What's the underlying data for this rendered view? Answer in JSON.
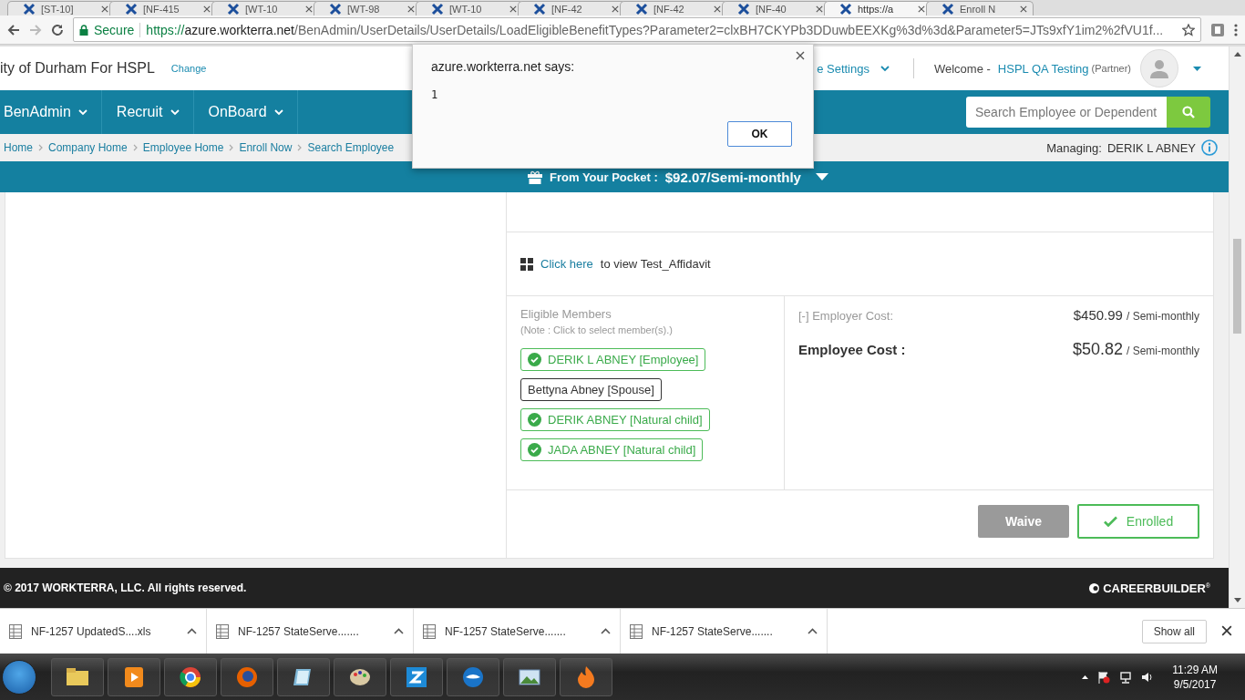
{
  "browser": {
    "tabs": [
      {
        "label": "[ST-10]",
        "selected": false
      },
      {
        "label": "[NF-415",
        "selected": false
      },
      {
        "label": "[WT-10",
        "selected": false
      },
      {
        "label": "[WT-98",
        "selected": false
      },
      {
        "label": "[WT-10",
        "selected": false
      },
      {
        "label": "[NF-42",
        "selected": false
      },
      {
        "label": "[NF-42",
        "selected": false
      },
      {
        "label": "[NF-40",
        "selected": false
      },
      {
        "label": "https://a",
        "selected": true
      },
      {
        "label": "Enroll N",
        "selected": false
      }
    ],
    "secure_label": "Secure",
    "url_scheme": "https://",
    "url_host": "azure.workterra.net",
    "url_path": "/BenAdmin/UserDetails/UserDetails/LoadEligibleBenefitTypes?Parameter2=clxBH7CKYPb3DDuwbEEXKg%3d%3d&Parameter5=JTs9xfY1im2%2fVU1f..."
  },
  "header": {
    "company": "ity of Durham For HSPL",
    "change_link": "Change",
    "settings": "e Settings",
    "welcome": "Welcome -",
    "user": "HSPL QA Testing",
    "role": "(Partner)"
  },
  "nav": {
    "items": [
      "BenAdmin",
      "Recruit",
      "OnBoard"
    ],
    "search": {
      "placeholder": "Search Employee or Dependent"
    }
  },
  "breadcrumbs": [
    "Home",
    "Company Home",
    "Employee Home",
    "Enroll Now",
    "Search Employee"
  ],
  "managing": {
    "label": "Managing:",
    "name": "DERIK L ABNEY"
  },
  "pocket": {
    "label": "From Your Pocket :",
    "amount": "$92.07/Semi-monthly"
  },
  "card": {
    "link": "Click here",
    "link_rest": "to view Test_Affidavit",
    "members_title": "Eligible Members",
    "members_note": "(Note : Click to select member(s).)",
    "members": [
      {
        "label": "DERIK L ABNEY [Employee]",
        "selected": true
      },
      {
        "label": "Bettyna Abney [Spouse]",
        "selected": false
      },
      {
        "label": "DERIK ABNEY [Natural child]",
        "selected": true
      },
      {
        "label": "JADA ABNEY [Natural child]",
        "selected": true
      }
    ],
    "employer_cost_label": "[-] Employer Cost:",
    "employer_cost": "$450.99",
    "employer_period": "/ Semi-monthly",
    "employee_cost_label": "Employee Cost :",
    "employee_cost": "$50.82",
    "employee_period": "/ Semi-monthly",
    "waive_button": "Waive",
    "enrolled_button": "Enrolled"
  },
  "footer": {
    "copyright": "© 2017 WORKTERRA, LLC. All rights reserved.",
    "brand": "CAREERBUILDER",
    "brand_mark": "®"
  },
  "downloads": {
    "items": [
      "NF-1257 UpdatedS....xls",
      "NF-1257 StateServe.......",
      "NF-1257 StateServe.......",
      "NF-1257 StateServe......."
    ],
    "show_all": "Show all"
  },
  "taskbar": {
    "time": "11:29 AM",
    "date": "9/5/2017"
  },
  "dialog": {
    "title": "azure.workterra.net says:",
    "message": "1",
    "ok_button": "OK"
  }
}
